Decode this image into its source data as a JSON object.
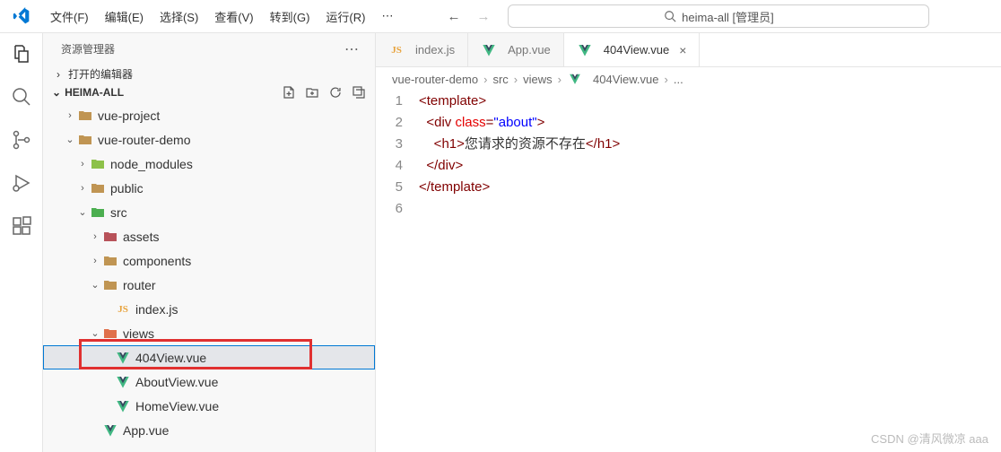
{
  "menu": {
    "file": "文件(F)",
    "edit": "编辑(E)",
    "select": "选择(S)",
    "view": "查看(V)",
    "go": "转到(G)",
    "run": "运行(R)"
  },
  "command_center": "heima-all [管理员]",
  "sidebar": {
    "title": "资源管理器",
    "open_editors": "打开的编辑器",
    "root": "HEIMA-ALL"
  },
  "tree": [
    {
      "id": "vue-project",
      "label": "vue-project",
      "depth": 1,
      "type": "folder",
      "chev": "›",
      "open": false
    },
    {
      "id": "vue-router-demo",
      "label": "vue-router-demo",
      "depth": 1,
      "type": "folder",
      "chev": "⌄",
      "open": true
    },
    {
      "id": "node_modules",
      "label": "node_modules",
      "depth": 2,
      "type": "nm",
      "chev": "›"
    },
    {
      "id": "public",
      "label": "public",
      "depth": 2,
      "type": "folder-red",
      "chev": "›"
    },
    {
      "id": "src",
      "label": "src",
      "depth": 2,
      "type": "src",
      "chev": "⌄"
    },
    {
      "id": "assets",
      "label": "assets",
      "depth": 3,
      "type": "assets",
      "chev": "›"
    },
    {
      "id": "components",
      "label": "components",
      "depth": 3,
      "type": "folder-red",
      "chev": "›"
    },
    {
      "id": "router",
      "label": "router",
      "depth": 3,
      "type": "folder-red",
      "chev": "⌄"
    },
    {
      "id": "index-js",
      "label": "index.js",
      "depth": 4,
      "type": "js",
      "chev": ""
    },
    {
      "id": "views",
      "label": "views",
      "depth": 3,
      "type": "views",
      "chev": "⌄"
    },
    {
      "id": "404view",
      "label": "404View.vue",
      "depth": 4,
      "type": "vue",
      "chev": "",
      "selected": true,
      "highlight": true
    },
    {
      "id": "aboutview",
      "label": "AboutView.vue",
      "depth": 4,
      "type": "vue",
      "chev": ""
    },
    {
      "id": "homeview",
      "label": "HomeView.vue",
      "depth": 4,
      "type": "vue",
      "chev": ""
    },
    {
      "id": "appvue",
      "label": "App.vue",
      "depth": 3,
      "type": "vue",
      "chev": ""
    }
  ],
  "tabs": [
    {
      "label": "index.js",
      "type": "js",
      "active": false,
      "close": false
    },
    {
      "label": "App.vue",
      "type": "vue",
      "active": false,
      "close": false
    },
    {
      "label": "404View.vue",
      "type": "vue",
      "active": true,
      "close": true
    }
  ],
  "breadcrumbs": {
    "p1": "vue-router-demo",
    "p2": "src",
    "p3": "views",
    "p4": "404View.vue",
    "p5": "..."
  },
  "code": {
    "lines": [
      "1",
      "2",
      "3",
      "4",
      "5",
      "6"
    ],
    "l1_tag": "template",
    "l2_tag": "div",
    "l2_attr": "class",
    "l2_val": "\"about\"",
    "l3_tag": "h1",
    "l3_text": "您请求的资源不存在"
  },
  "watermark": "CSDN @清风微凉 aaa"
}
